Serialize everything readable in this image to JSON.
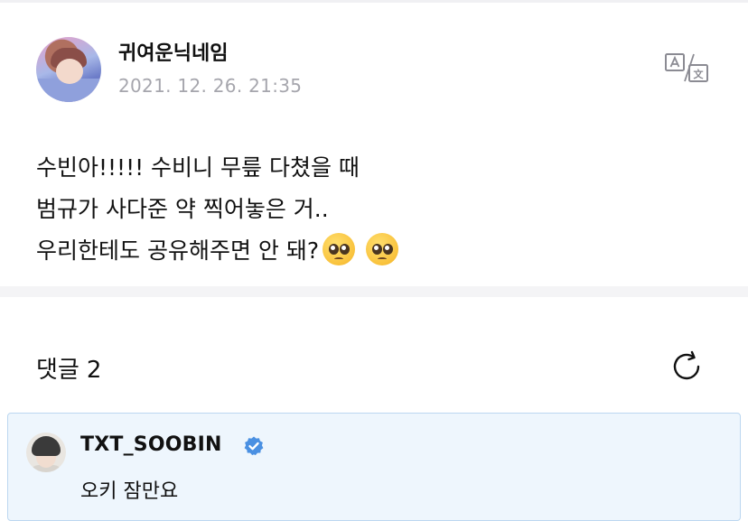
{
  "post": {
    "author": "귀여운닉네임",
    "date": "2021. 12. 26. 21:35",
    "translate_icon": "translate-icon",
    "lines": [
      "수빈아!!!!! 수비니 무릎 다쳤을 때",
      "범규가 사다준 약 찍어놓은 거..",
      "우리한테도 공유해주면 안 돼?"
    ],
    "emoji": "pleading-face-emoji"
  },
  "comments": {
    "label": "댓글",
    "count": "2",
    "refresh_icon": "refresh-icon"
  },
  "comment": {
    "author": "TXT_SOOBIN",
    "verified_icon": "verified-badge-icon",
    "text": "오키 잠만요"
  },
  "colors": {
    "date_gray": "#a6a6ad",
    "divider": "#f4f4f6",
    "comment_bg": "#eef6fd",
    "comment_border": "#bcd7f0",
    "verified_blue": "#4a90e2"
  }
}
